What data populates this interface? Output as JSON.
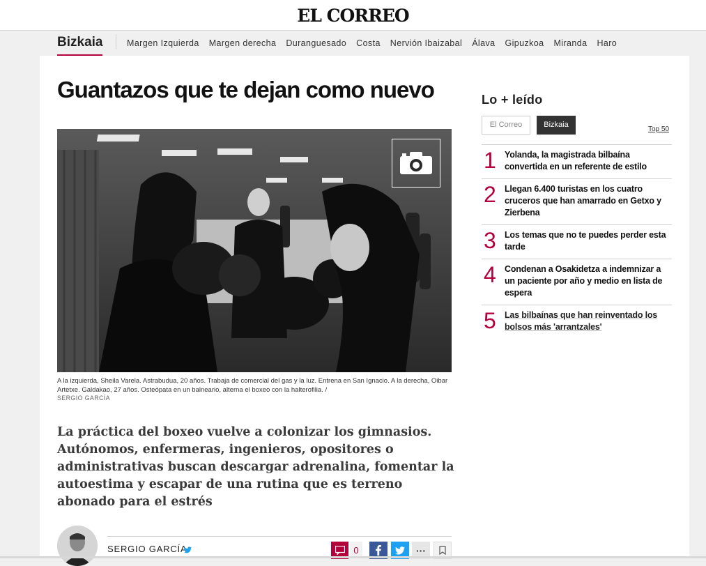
{
  "site": {
    "logo": "EL CORREO"
  },
  "section_nav": {
    "title": "Bizkaia",
    "links": [
      "Margen Izquierda",
      "Margen derecha",
      "Duranguesado",
      "Costa",
      "Nervión Ibaizabal",
      "Álava",
      "Gipuzkoa",
      "Miranda",
      "Haro"
    ]
  },
  "article": {
    "headline": "Guantazos que te dejan como nuevo",
    "photo_caption": "A la izquierda, Sheila Varela. Astrabudua, 20 años. Trabaja de comercial del gas y la luz. Entrena en San Ignacio. A la derecha, Oibar Artetxe. Galdakao, 27 años. Osteópata en un balneario, alterna el boxeo con la halterofilia. /",
    "photo_credit": "SERGIO GARCÍA",
    "lead": "La práctica del boxeo vuelve a colonizar los gimnasios. Autónomos, enfermeras, ingenieros, opositores o administrativas buscan descargar adrenalina, fomentar la autoestima y escapar de una rutina que es terreno abonado para el estrés",
    "author": "SERGIO GARCÍA",
    "comment_count": "0"
  },
  "sidebar": {
    "title": "Lo + leído",
    "tabs": [
      "El Correo",
      "Bizkaia"
    ],
    "active_tab": "Bizkaia",
    "top_link": "Top 50",
    "items": [
      {
        "rank": "1",
        "text": "Yolanda, la magistrada bilbaína convertida en un referente de estilo"
      },
      {
        "rank": "2",
        "text": "Llegan 6.400 turistas en los cuatro cruceros que han amarrado en Getxo y Zierbena"
      },
      {
        "rank": "3",
        "text": "Los temas que no te puedes perder esta tarde"
      },
      {
        "rank": "4",
        "text": "Condenan a Osakidetza a indemnizar a un paciente por año y medio en lista de espera"
      },
      {
        "rank": "5",
        "text": "Las bilbaínas que han reinventado los bolsos más 'arrantzales'"
      }
    ]
  },
  "colors": {
    "accent": "#b3003b",
    "facebook": "#3b5998",
    "twitter": "#1da1f2"
  },
  "icons": [
    "camera-icon",
    "twitter-icon",
    "comment-icon",
    "facebook-icon",
    "more-icon",
    "bookmark-icon"
  ]
}
